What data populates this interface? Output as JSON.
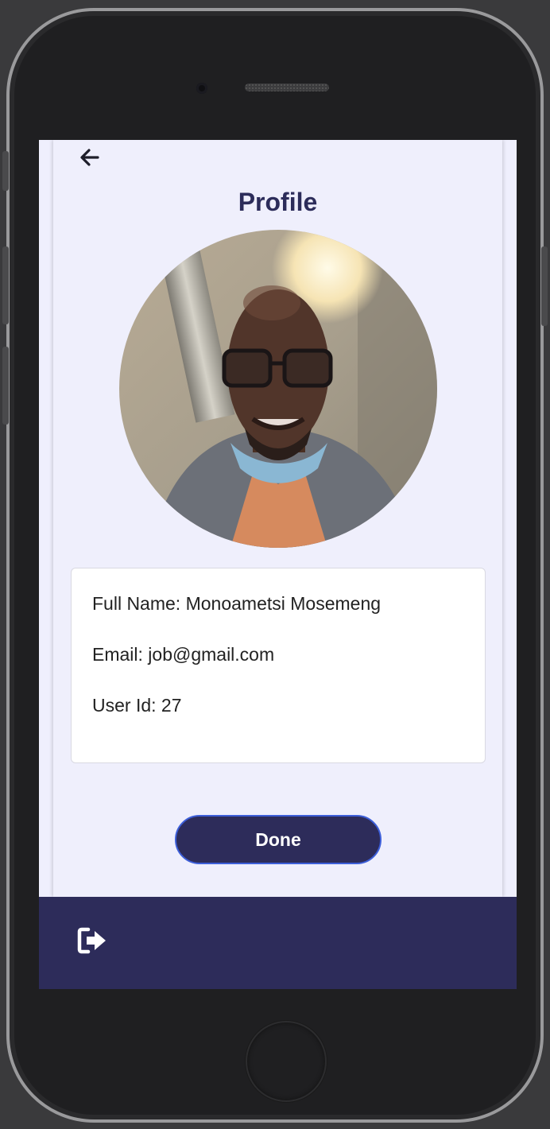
{
  "header": {
    "back_icon": "arrow-left-icon",
    "title": "Profile"
  },
  "profile": {
    "avatar": "profile-photo",
    "full_name_line": "Full Name: Monoametsi Mosemeng",
    "email_line": "Email: job@gmail.com",
    "user_id_line": "User Id: 27"
  },
  "actions": {
    "done_label": "Done"
  },
  "bottom_bar": {
    "logout_icon": "sign-out-icon"
  },
  "colors": {
    "primary": "#2d2c5a",
    "background": "#efeffc",
    "card": "#ffffff",
    "button_border": "#3d5fd9"
  }
}
